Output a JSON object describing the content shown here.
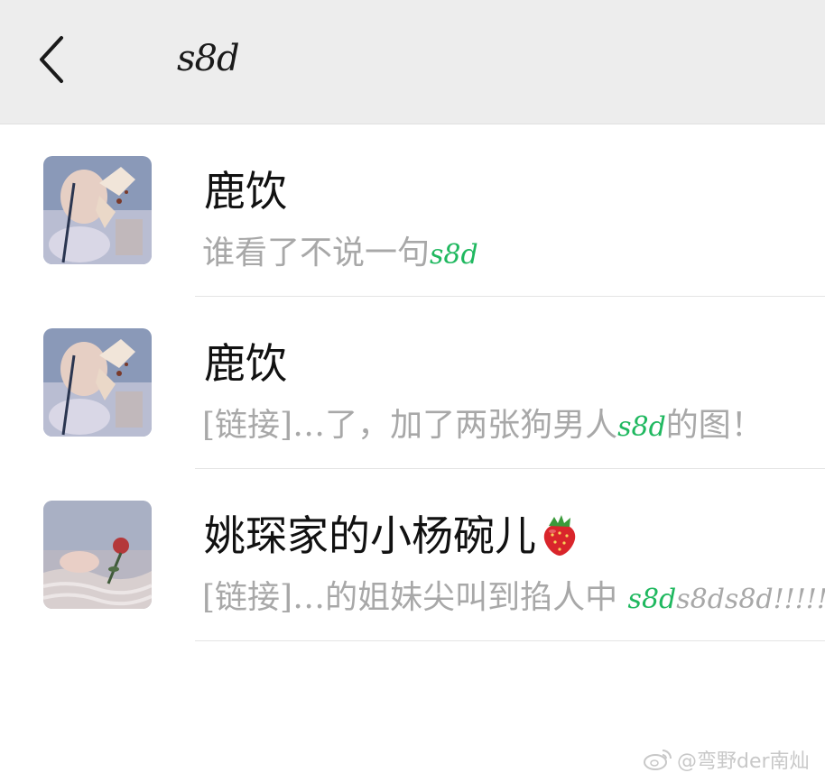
{
  "header": {
    "title": "s8d"
  },
  "results": [
    {
      "name": "鹿饮",
      "snippet_prefix": "谁看了不说一句",
      "snippet_match": "s8d",
      "snippet_suffix": ""
    },
    {
      "name": "鹿饮",
      "snippet_prefix": "[链接]…了，加了两张狗男人",
      "snippet_match": "s8d",
      "snippet_suffix": "的图！"
    },
    {
      "name": "姚琛家的小杨碗儿",
      "snippet_prefix": "[链接]…的姐妹尖叫到掐人中 ",
      "snippet_match": "s8d",
      "snippet_suffix": "s8ds8d!!!!!"
    }
  ],
  "watermark": {
    "text": "@弯野der南灿"
  },
  "colors": {
    "header_bg": "#ededed",
    "highlight": "#1fb85f",
    "snippet_text": "#a8a8a8"
  }
}
